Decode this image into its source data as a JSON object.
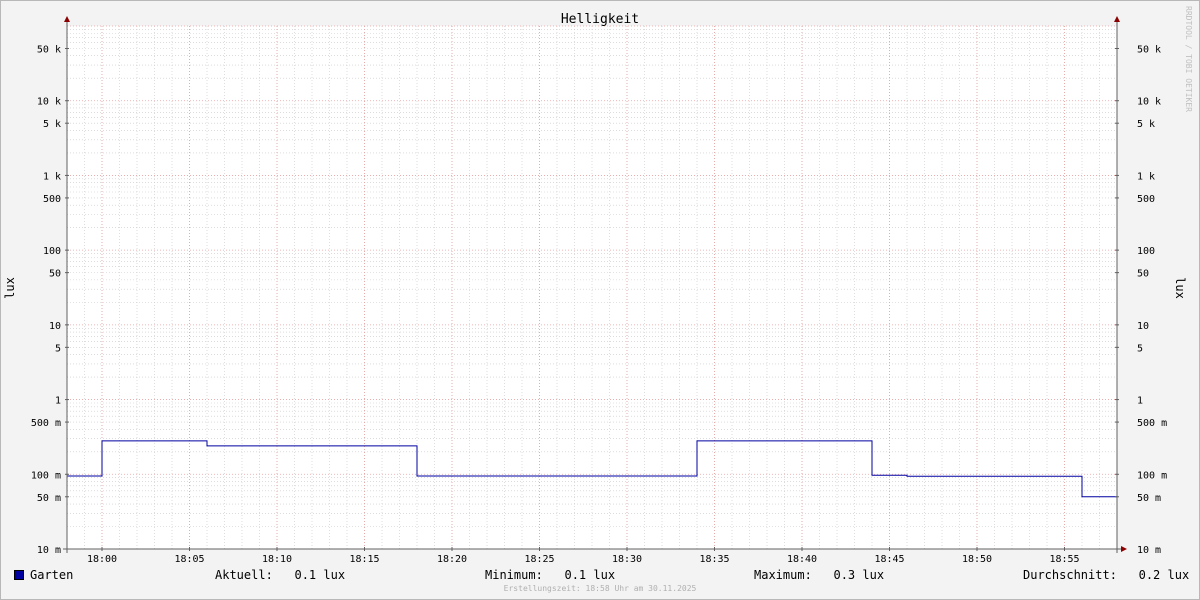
{
  "watermark": "RRDTOOL / TOBI OETIKER",
  "chart_data": {
    "type": "line",
    "title": "Helligkeit",
    "ylabel": "lux",
    "yscale": "log",
    "ylim": [
      0.01,
      100000
    ],
    "xlim": [
      "17:58",
      "18:58"
    ],
    "x_ticks": [
      "18:00",
      "18:05",
      "18:10",
      "18:15",
      "18:20",
      "18:25",
      "18:30",
      "18:35",
      "18:40",
      "18:45",
      "18:50",
      "18:55"
    ],
    "y_ticks": [
      {
        "value": 50000,
        "label": "50 k"
      },
      {
        "value": 10000,
        "label": "10 k"
      },
      {
        "value": 5000,
        "label": "5 k"
      },
      {
        "value": 1000,
        "label": "1 k"
      },
      {
        "value": 500,
        "label": "500"
      },
      {
        "value": 100,
        "label": "100"
      },
      {
        "value": 50,
        "label": "50"
      },
      {
        "value": 10,
        "label": "10"
      },
      {
        "value": 5,
        "label": "5"
      },
      {
        "value": 1,
        "label": "1"
      },
      {
        "value": 0.5,
        "label": "500 m"
      },
      {
        "value": 0.1,
        "label": "100 m"
      },
      {
        "value": 0.05,
        "label": "50 m"
      },
      {
        "value": 0.01,
        "label": "10 m"
      }
    ],
    "grid": true,
    "colors": {
      "series": "#0000a0",
      "major_grid": "#e8a0a0",
      "minor_grid": "#c8c8c8",
      "axis": "#606060",
      "arrow": "#8b0000"
    },
    "series": [
      {
        "name": "Garten",
        "x": [
          "17:58",
          "18:00",
          "18:00",
          "18:06",
          "18:06",
          "18:18",
          "18:18",
          "18:34",
          "18:34",
          "18:44",
          "18:44",
          "18:46",
          "18:46",
          "18:56",
          "18:56",
          "18:58"
        ],
        "y": [
          0.095,
          0.095,
          0.28,
          0.28,
          0.24,
          0.24,
          0.095,
          0.095,
          0.28,
          0.28,
          0.097,
          0.097,
          0.094,
          0.094,
          0.05,
          0.05
        ]
      }
    ]
  },
  "legend": {
    "series_name": "Garten",
    "current": "Aktuell:   0.1 lux",
    "minimum": "Minimum:   0.1 lux",
    "maximum": "Maximum:   0.3 lux",
    "average": "Durchschnitt:   0.2 lux"
  },
  "created": "Erstellungszeit: 18:58 Uhr am 30.11.2025"
}
